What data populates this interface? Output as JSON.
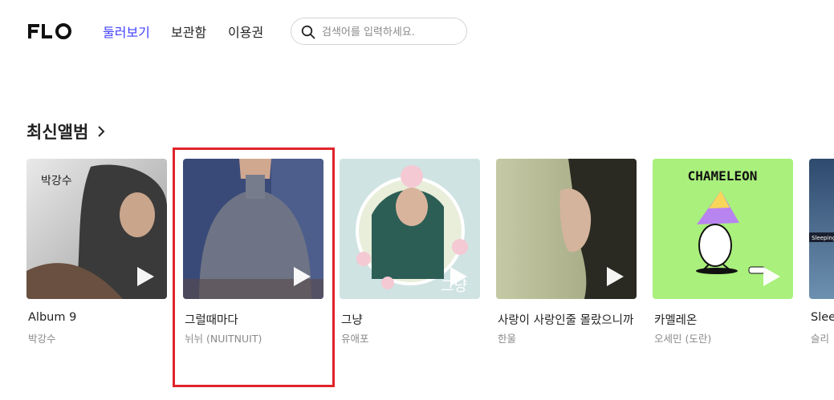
{
  "header": {
    "logo": "FLO",
    "nav": [
      {
        "label": "둘러보기",
        "active": true
      },
      {
        "label": "보관함",
        "active": false
      },
      {
        "label": "이용권",
        "active": false
      }
    ],
    "search": {
      "placeholder": "검색어를 입력하세요.",
      "icon": "search-icon"
    }
  },
  "section": {
    "title": "최신앨범",
    "more_icon": "chevron-right-icon"
  },
  "albums": [
    {
      "title": "Album 9",
      "artist": "박강수",
      "cover_text": "박강수"
    },
    {
      "title": "그럴때마다",
      "artist": "뉘뉘 (NUITNUIT)"
    },
    {
      "title": "그냥",
      "artist": "유애포",
      "cover_text": "그냥"
    },
    {
      "title": "사랑이 사랑인줄 몰랐으니까",
      "artist": "한울"
    },
    {
      "title": "카멜레온",
      "artist": "오세민 (도란)",
      "cover_text": "CHAMELEON"
    },
    {
      "title": "Slee",
      "artist": "슬리",
      "cover_text": "Sleeping"
    }
  ],
  "colors": {
    "accent": "#3f3fff",
    "highlight": "#e0242a"
  }
}
